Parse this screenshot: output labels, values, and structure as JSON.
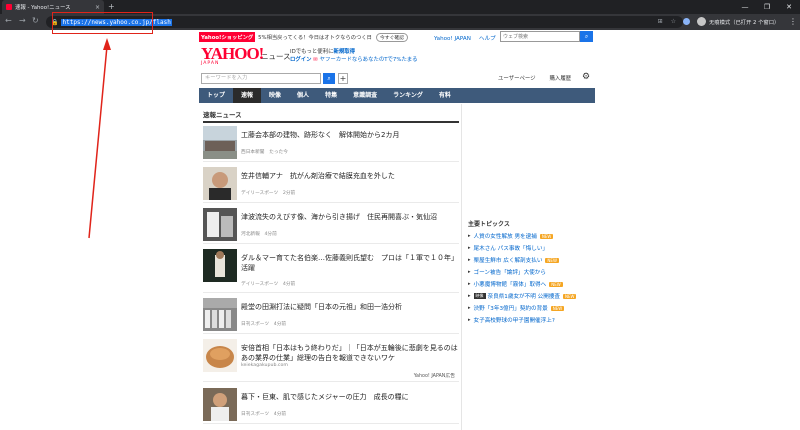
{
  "browser": {
    "tab_title": "速報 - Yahoo!ニュース",
    "tab_close": "×",
    "new_tab": "+",
    "win_min": "—",
    "win_max": "❐",
    "win_close": "✕",
    "url": "https://news.yahoo.co.jp/flash",
    "profile_label": "无痕模式（已打开 2 个窗口）",
    "back_icon": "arrow-left",
    "forward_icon": "arrow-right",
    "reload_icon": "reload",
    "star_icon": "star",
    "menu_icon": "more-vert"
  },
  "header": {
    "shop_badge": "Yahoo!ショッピング",
    "promo_text": "5%相当戻ってくる！今日はオトクならのつく日",
    "promo_button": "今すぐ確認",
    "links": [
      "Yahoo! JAPAN",
      "ヘルプ"
    ],
    "web_search_placeholder": "ウェブ検索",
    "logo_text": "YAHOO!",
    "logo_sub": "JAPAN",
    "logo_news": "ニュース",
    "login_promo_line1_prefix": "IDでもっと便利に",
    "login_promo_line1_link": "新規取得",
    "login_link": "ログイン",
    "login_promo_line2": "ヤフーカードならあなたのTで7%たまる",
    "keyword_placeholder": "キーワードを入力",
    "plus_label": "+",
    "user_review": "ユーザーページ",
    "purchase_history": "購入履歴"
  },
  "nav": {
    "tabs": [
      "トップ",
      "速報",
      "映像",
      "個人",
      "特集",
      "意識調査",
      "ランキング",
      "有料"
    ],
    "active_index": 1
  },
  "main": {
    "section_title": "速報ニュース",
    "articles": [
      {
        "title": "工藤会本部の建物、跡形なく　解体開始から2カ月",
        "source": "西日本新聞　たった今"
      },
      {
        "title": "笠井信輔アナ　抗がん剤治療で結膜充血を外した",
        "source": "デイリースポーツ　2分前"
      },
      {
        "title": "津波流失のえびす像、海から引き揚げ　住民再開喜ぶ・気仙沼",
        "source": "河北新報　4分前"
      },
      {
        "title": "ダル＆マー育てた名伯楽…佐藤義則氏望む　プロは「１軍で１０年」活躍",
        "source": "デイリースポーツ　4分前"
      },
      {
        "title": "殿堂の田淵打法に疑問「日本の元祖」和田一浩分析",
        "source": "日刊スポーツ　4分前"
      },
      {
        "title": "安倍首相「日本はもう終わりだ」｜「日本が五輪後に悲劇を見るのはあの業界の仕業」総理の告白を報道できないワケ",
        "source": "keiekagakupub.com",
        "ad": "Yahoo! JAPAN広告"
      },
      {
        "title": "暮下・巨東、肌で感じたメジャーの圧力　成長の糧に",
        "source": "日刊スポーツ　4分前"
      }
    ]
  },
  "sidebar": {
    "trend_title": "主要トピックス",
    "trends": [
      {
        "text": "人質の女性解放 男を逮捕",
        "badge": "NEW"
      },
      {
        "text": "尾木さん パス事故「悔しい」",
        "badge": ""
      },
      {
        "text": "栗屋生鮮市 広く解剖支払い",
        "badge": "NEW"
      },
      {
        "text": "ゴーン被告「論評」大使から",
        "badge": ""
      },
      {
        "text": "小悪魔博物館「霧体」取得へ",
        "badge": "NEW"
      },
      {
        "text": "奈良県1歳女が不明 公開捜査",
        "badge": "NEW",
        "video": "映像"
      },
      {
        "text": "渋野「3年3億円」契約の背景",
        "badge": "NEW"
      },
      {
        "text": "女子高校野球の甲子園開催浮上?",
        "badge": ""
      }
    ]
  },
  "colors": {
    "brand_red": "#ff0033",
    "nav_bg": "#3e5a7b",
    "link_blue": "#0066cc",
    "annotation_red": "#e0241a"
  }
}
